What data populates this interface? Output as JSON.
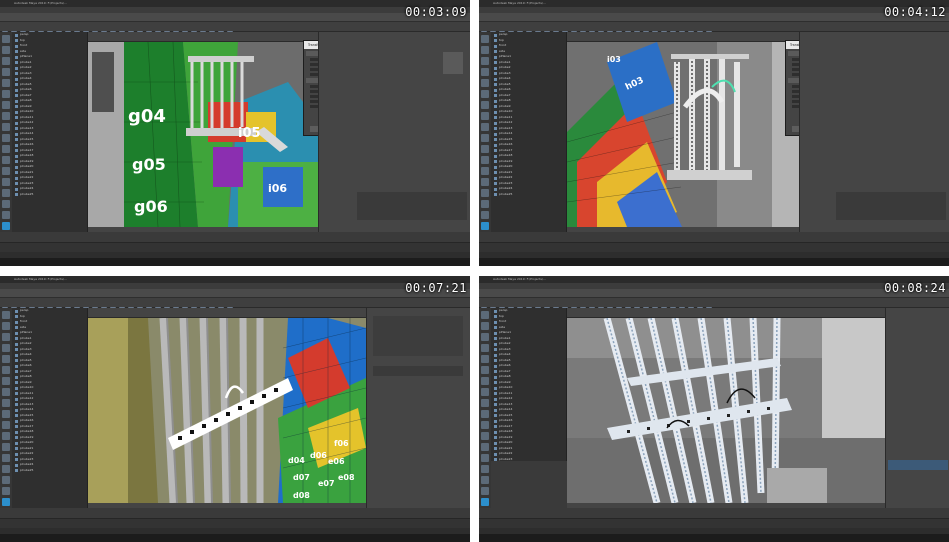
{
  "frames": [
    {
      "timecode": "00:03:09",
      "window_title": "Autodesk Maya 2019: F:/Projects/...",
      "menu": [
        "File",
        "Edit",
        "Create",
        "Select",
        "Modify",
        "Display",
        "Windows",
        "Mesh"
      ],
      "dialog_title": "Transfer Attributes Options",
      "uv_labels": [
        "g04",
        "g05",
        "g06",
        "i05",
        "i06"
      ]
    },
    {
      "timecode": "00:04:12",
      "window_title": "Autodesk Maya 2019: F:/Projects/...",
      "menu": [
        "File",
        "Edit",
        "Create",
        "Select",
        "Modify",
        "Display",
        "Windows",
        "Mesh"
      ],
      "dialog_title": "Transfer Attributes Options",
      "uv_labels": [
        "h03",
        "i03"
      ]
    },
    {
      "timecode": "00:07:21",
      "window_title": "Autodesk Maya 2019: F:/Projects/...",
      "menu": [
        "File",
        "Edit",
        "Create",
        "Select",
        "Modify",
        "Display",
        "Windows",
        "Mesh"
      ],
      "uv_labels": [
        "d04",
        "d06",
        "e07",
        "d07",
        "e08",
        "d08",
        "f06",
        "e06"
      ]
    },
    {
      "timecode": "00:08:24",
      "window_title": "Autodesk Maya 2019: F:/Projects/...",
      "menu": [
        "File",
        "Edit",
        "Create",
        "Select",
        "Modify",
        "Display",
        "Windows",
        "Mesh"
      ]
    }
  ],
  "outliner_items": [
    "persp",
    "top",
    "front",
    "side",
    "pPlane1",
    "pCube1",
    "pCube2",
    "pCube3",
    "pCube4",
    "pCube5",
    "pCube6",
    "pCube7",
    "pCube8",
    "pCube9",
    "pCube10",
    "pCube11",
    "pCube12",
    "pCube13",
    "pCube14",
    "pCube15",
    "pCube16",
    "pCube17",
    "pCube18",
    "pCube19",
    "pCube20",
    "pCube21",
    "pCube22",
    "pCube23",
    "pCube24",
    "pCube25",
    "pCube26",
    "pCube27",
    "pCube28",
    "pCube29",
    "pCube30",
    "pCube31"
  ]
}
